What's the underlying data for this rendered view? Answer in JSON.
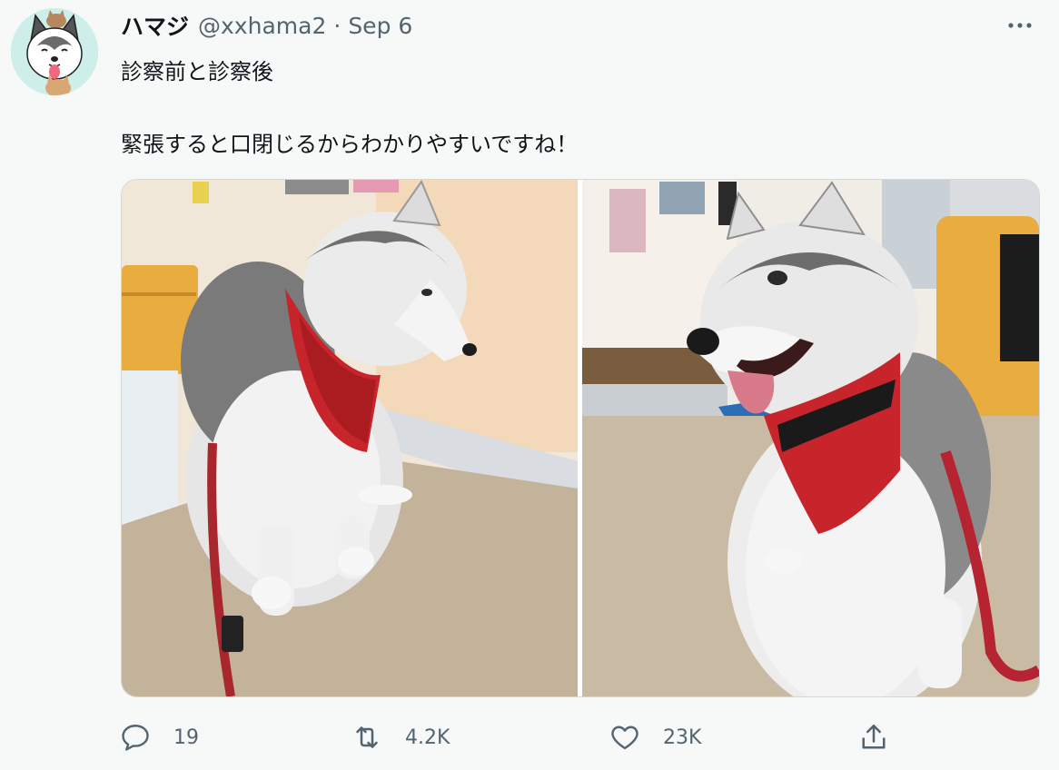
{
  "tweet": {
    "author_name": "ハマジ",
    "handle": "@xxhama2",
    "separator": "·",
    "date": "Sep 6",
    "text_line1": "診察前と診察後",
    "text_line2": "緊張すると口閉じるからわかりやすいですね！"
  },
  "icons": {
    "more": "more-horizontal-icon",
    "reply": "reply-icon",
    "retweet": "retweet-icon",
    "like": "heart-icon",
    "share": "share-icon"
  },
  "actions": {
    "reply_count": "19",
    "retweet_count": "4.2K",
    "like_count": "23K"
  },
  "colors": {
    "background": "#f7f9f9",
    "text": "#0f1419",
    "secondary": "#536471",
    "avatar_bg": "#cdeee9",
    "bandana_red": "#c8242b"
  }
}
